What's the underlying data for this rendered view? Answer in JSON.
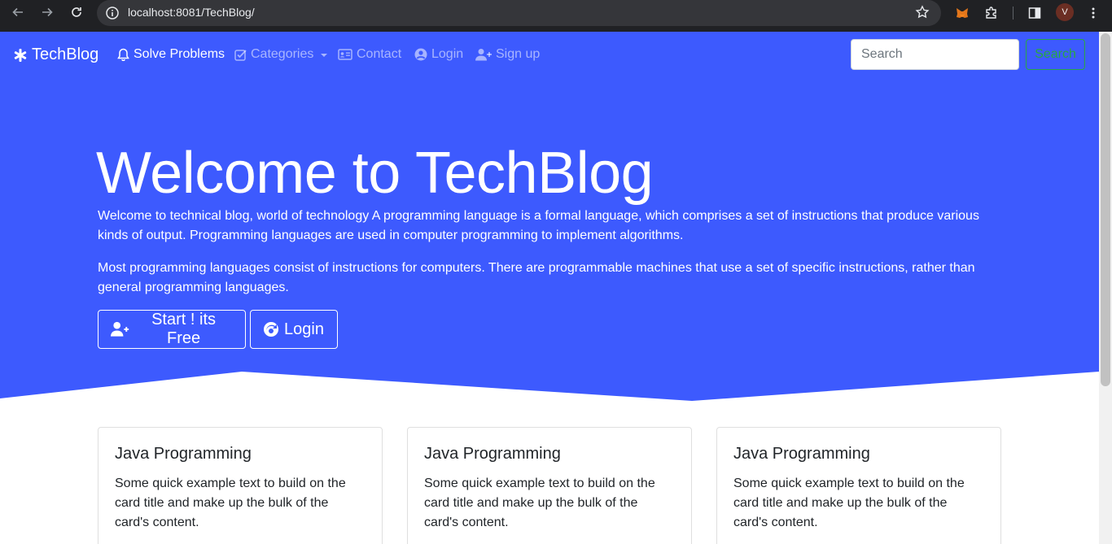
{
  "browser": {
    "url": "localhost:8081/TechBlog/",
    "profile_initial": "V"
  },
  "navbar": {
    "brand": "TechBlog",
    "items": [
      {
        "label": "Solve Problems",
        "icon": "bell-icon"
      },
      {
        "label": "Categories",
        "icon": "check-square-icon"
      },
      {
        "label": "Contact",
        "icon": "id-card-icon"
      },
      {
        "label": "Login",
        "icon": "user-circle-icon"
      },
      {
        "label": "Sign up",
        "icon": "user-plus-icon"
      }
    ],
    "search_placeholder": "Search",
    "search_button": "Search"
  },
  "hero": {
    "title": "Welcome to TechBlog",
    "paragraph1": "Welcome to technical blog, world of technology A programming language is a formal language, which comprises a set of instructions that produce various kinds of output. Programming languages are used in computer programming to implement algorithms.",
    "paragraph2": "Most programming languages consist of instructions for computers. There are programmable machines that use a set of specific instructions, rather than general programming languages.",
    "start_button": "Start ! its Free",
    "login_button": "Login"
  },
  "cards": [
    {
      "title": "Java Programming",
      "text": "Some quick example text to build on the card title and make up the bulk of the card's content."
    },
    {
      "title": "Java Programming",
      "text": "Some quick example text to build on the card title and make up the bulk of the card's content."
    },
    {
      "title": "Java Programming",
      "text": "Some quick example text to build on the card title and make up the bulk of the card's content."
    }
  ],
  "colors": {
    "primary": "#3d5afe",
    "success": "#28a745",
    "chrome": "#202124"
  }
}
